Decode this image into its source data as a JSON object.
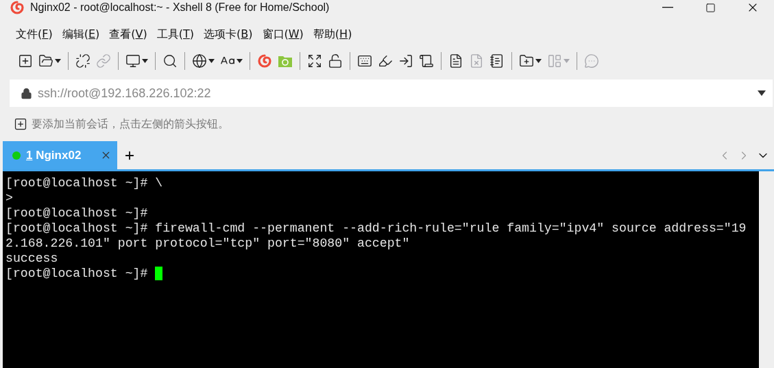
{
  "window": {
    "title": "Nginx02 - root@localhost:~ - Xshell 8 (Free for Home/School)"
  },
  "menu": [
    {
      "before": "文件(",
      "key": "F",
      "after": ")"
    },
    {
      "before": "编辑(",
      "key": "E",
      "after": ")"
    },
    {
      "before": "查看(",
      "key": "V",
      "after": ")"
    },
    {
      "before": "工具(",
      "key": "T",
      "after": ")"
    },
    {
      "before": "选项卡(",
      "key": "B",
      "after": ")"
    },
    {
      "before": "窗口(",
      "key": "W",
      "after": ")"
    },
    {
      "before": "帮助(",
      "key": "H",
      "after": ")"
    }
  ],
  "toolbar": [
    [
      {
        "disabled": false,
        "dropdown": false
      },
      {
        "disabled": false,
        "dropdown": true
      }
    ],
    [
      {
        "disabled": false,
        "dropdown": false
      },
      {
        "disabled": true,
        "dropdown": false
      }
    ],
    [
      {
        "disabled": false,
        "dropdown": true
      }
    ],
    [
      {
        "disabled": false,
        "dropdown": false
      }
    ],
    [
      {
        "disabled": false,
        "dropdown": true
      },
      {
        "disabled": false,
        "dropdown": true
      }
    ],
    [
      {
        "disabled": false,
        "dropdown": false
      },
      {
        "disabled": false,
        "dropdown": false
      }
    ],
    [
      {
        "disabled": false,
        "dropdown": false
      },
      {
        "disabled": false,
        "dropdown": false
      }
    ],
    [
      {
        "disabled": false,
        "dropdown": false
      },
      {
        "disabled": false,
        "dropdown": false
      },
      {
        "disabled": false,
        "dropdown": false
      },
      {
        "disabled": false,
        "dropdown": false
      }
    ],
    [
      {
        "disabled": false,
        "dropdown": false
      },
      {
        "disabled": true,
        "dropdown": false
      },
      {
        "disabled": false,
        "dropdown": false
      }
    ],
    [
      {
        "disabled": false,
        "dropdown": true
      },
      {
        "disabled": true,
        "dropdown": true
      }
    ],
    [
      {
        "disabled": true,
        "dropdown": false
      }
    ]
  ],
  "address_bar": {
    "value": "ssh://root@192.168.226.102:22"
  },
  "session_hint": "要添加当前会话，点击左侧的箭头按钮。",
  "tabs": [
    {
      "number": "1",
      "label": "Nginx02",
      "selected": true,
      "connected": true
    }
  ],
  "terminal": {
    "lines": [
      "[root@localhost ~]# \\",
      ">",
      "[root@localhost ~]#",
      "[root@localhost ~]# firewall-cmd --permanent --add-rich-rule=\"rule family=\"ipv4\" source address=\"19",
      "2.168.226.101\" port protocol=\"tcp\" port=\"8080\" accept\"",
      "success",
      "[root@localhost ~]# "
    ],
    "cursor_visible": true
  }
}
